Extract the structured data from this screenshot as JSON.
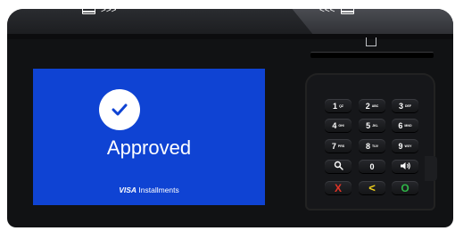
{
  "device": {
    "swipe_left_arrows": ">>>",
    "swipe_right_arrows": "<<<"
  },
  "screen": {
    "status_text": "Approved",
    "brand_visa": "VISA",
    "brand_product": "Installments",
    "background_color": "#0f43d3"
  },
  "keypad": {
    "keys": [
      {
        "digit": "1",
        "letters": "QZ"
      },
      {
        "digit": "2",
        "letters": "ABC"
      },
      {
        "digit": "3",
        "letters": "DEF"
      },
      {
        "digit": "4",
        "letters": "GHI"
      },
      {
        "digit": "5",
        "letters": "JKL"
      },
      {
        "digit": "6",
        "letters": "MNO"
      },
      {
        "digit": "7",
        "letters": "PRS"
      },
      {
        "digit": "8",
        "letters": "TUV"
      },
      {
        "digit": "9",
        "letters": "WXY"
      }
    ],
    "zero": "0",
    "search_icon": "search-icon",
    "volume_icon": "speaker-icon",
    "cancel_symbol": "X",
    "back_symbol": "<",
    "enter_symbol": "O",
    "cancel_color": "#e23427",
    "back_color": "#f2d21b",
    "enter_color": "#2fb848"
  }
}
